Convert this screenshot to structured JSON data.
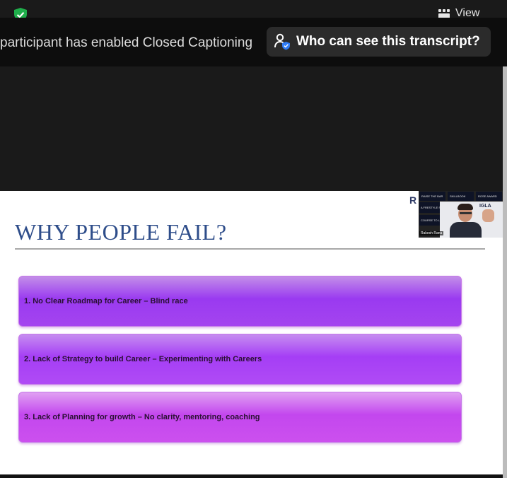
{
  "toolbar": {
    "security_icon": "shield-check-icon",
    "view_label": "View",
    "view_icon": "grid-icon"
  },
  "caption": {
    "text": "participant has enabled Closed Captioning",
    "who_button_label": "Who can see this transcript?",
    "who_icon": "person-shield-icon"
  },
  "slide": {
    "title": "WHY PEOPLE FAIL?",
    "items": [
      "1. No Clear Roadmap for Career – Blind race",
      "2. Lack of Strategy to build Career – Experimenting with Careers",
      "3. Lack of Planning for growth – No clarity, mentoring, coaching"
    ],
    "logo_letter": "R"
  },
  "presenter": {
    "name": "Rakesh Rana",
    "brand": "IGLA",
    "tile_labels": [
      "RAISE THE BAR",
      "SKILLBOOK",
      "ROSE AWARD",
      "A FRESTYLE STORY LAB",
      "COURSE TO LEADERSHIP"
    ]
  },
  "colors": {
    "title_blue": "#2e4d8a",
    "card_purple": "#a444ef",
    "shield_green": "#22c55e",
    "caption_bg": "#0d0d0d"
  }
}
